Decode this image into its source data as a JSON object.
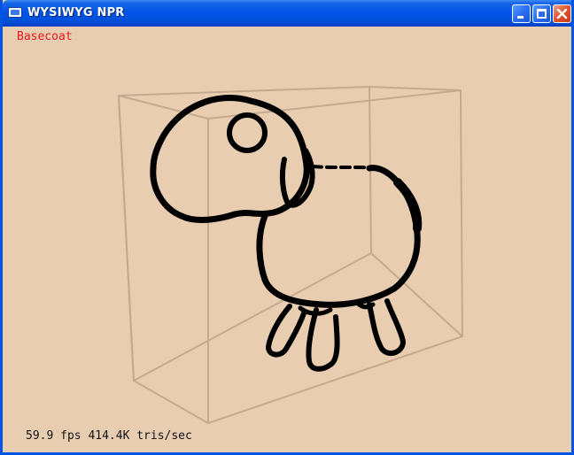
{
  "window": {
    "title": "WYSIWYG NPR",
    "app_icon": "window-app-icon",
    "controls": [
      "minimize-icon",
      "maximize-icon",
      "close-icon"
    ]
  },
  "viewport": {
    "render_mode": "Basecoat",
    "stats": "59.9 fps 414.4K tris/sec",
    "colors": {
      "background": "#e8cdb1",
      "mode_label": "#e8141e",
      "stroke": "#000000",
      "box_lines": "#bfa48a"
    }
  }
}
